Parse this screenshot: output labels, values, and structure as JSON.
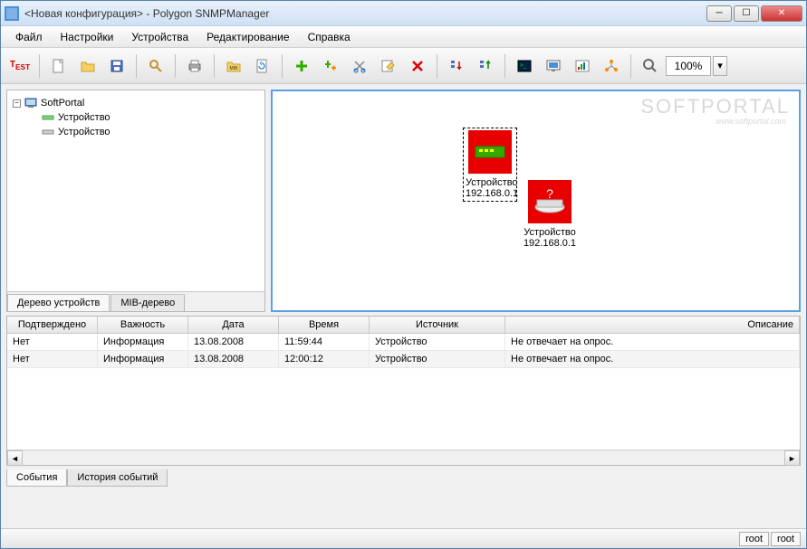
{
  "titlebar": {
    "title": "<Новая конфигурация> - Polygon SNMPManager"
  },
  "menu": {
    "file": "Файл",
    "settings": "Настройки",
    "devices": "Устройства",
    "edit": "Редактирование",
    "help": "Справка"
  },
  "toolbar": {
    "zoom": "100%"
  },
  "tree": {
    "root": "SoftPortal",
    "children": [
      "Устройство",
      "Устройство"
    ],
    "tab_device_tree": "Дерево устройств",
    "tab_mib_tree": "MIB-дерево"
  },
  "canvas": {
    "devices": [
      {
        "name": "Устройство",
        "ip": "192.168.0.1",
        "selected": true
      },
      {
        "name": "Устройство",
        "ip": "192.168.0.1",
        "selected": false
      }
    ]
  },
  "grid": {
    "columns": [
      "Подтверждено",
      "Важность",
      "Дата",
      "Время",
      "Источник",
      "Описание"
    ],
    "rows": [
      {
        "ack": "Нет",
        "severity": "Информация",
        "date": "13.08.2008",
        "time": "11:59:44",
        "source": "Устройство",
        "desc": "Не отвечает на опрос."
      },
      {
        "ack": "Нет",
        "severity": "Информация",
        "date": "13.08.2008",
        "time": "12:00:12",
        "source": "Устройство",
        "desc": "Не отвечает на опрос."
      }
    ],
    "tab_events": "События",
    "tab_history": "История событий"
  },
  "status": {
    "user1": "root",
    "user2": "root"
  },
  "watermark": {
    "main": "SOFTPORTAL",
    "sub": "www.softportal.com"
  }
}
